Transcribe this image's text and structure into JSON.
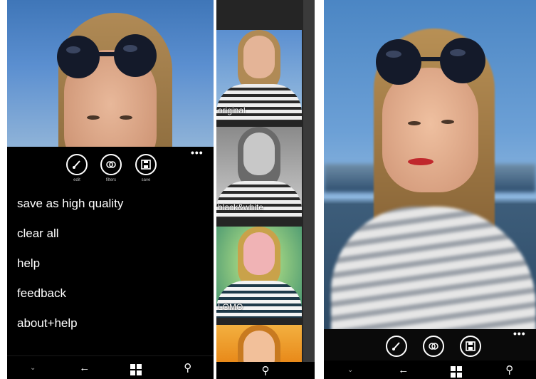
{
  "panel_left": {
    "app_bar": {
      "buttons": [
        {
          "label": "edit",
          "icon": "brush-icon"
        },
        {
          "label": "filters",
          "icon": "filters-icon"
        },
        {
          "label": "save",
          "icon": "save-icon"
        }
      ],
      "more": "•••"
    },
    "menu_items": [
      "save as high quality",
      "clear all",
      "help",
      "feedback",
      "about+help"
    ],
    "navbar": [
      "chevron-down-icon",
      "back-icon",
      "windows-icon",
      "search-icon"
    ]
  },
  "panel_middle": {
    "filters": [
      {
        "label": "original",
        "tint": "#5b8fd0"
      },
      {
        "label": "black&white",
        "tint": "#bdbdbd"
      },
      {
        "label": "LOMO",
        "tint": "#7fd0a0"
      },
      {
        "label": "",
        "tint": "#e89a2a"
      }
    ],
    "navbar": [
      "search-icon"
    ]
  },
  "panel_right": {
    "app_bar": {
      "buttons": [
        {
          "icon": "brush-icon"
        },
        {
          "icon": "filters-icon"
        },
        {
          "icon": "save-icon"
        }
      ],
      "more": "•••"
    },
    "navbar": [
      "chevron-down-icon",
      "back-icon",
      "windows-icon",
      "search-icon"
    ]
  }
}
